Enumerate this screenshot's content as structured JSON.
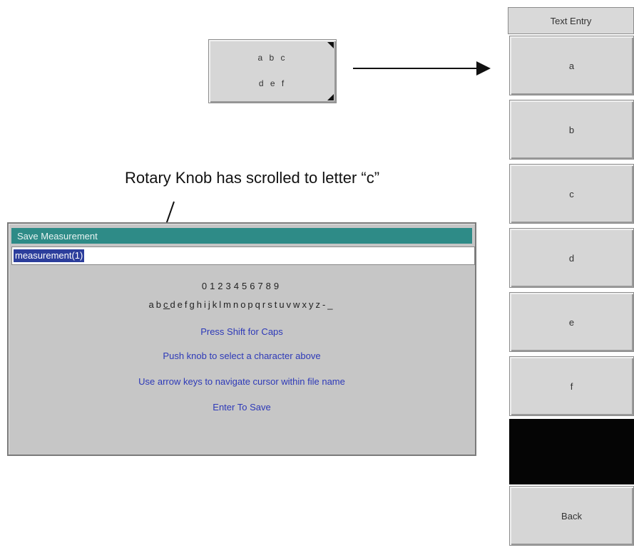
{
  "small_key": {
    "line1": "a b c",
    "line2": "d e f"
  },
  "callout": "Rotary Knob has scrolled to letter “c”",
  "panel": {
    "title": "Text Entry",
    "keys": [
      "a",
      "b",
      "c",
      "d",
      "e",
      "f"
    ],
    "back": "Back"
  },
  "dialog": {
    "title": "Save Measurement",
    "filename": "measurement(1)",
    "digits": "0123456789",
    "letters_before": "ab",
    "letters_current": "c",
    "letters_after": "defghijklmnopqrstuvwxyz-_",
    "msg_shift": "Press Shift for Caps",
    "msg_push": "Push knob to select a character above",
    "msg_arrows": "Use arrow keys to navigate cursor within file name",
    "msg_enter": "Enter To Save"
  },
  "colors": {
    "title_bar": "#2e8b87",
    "instructions": "#2d39b8",
    "selection": "#2c3e9c"
  }
}
